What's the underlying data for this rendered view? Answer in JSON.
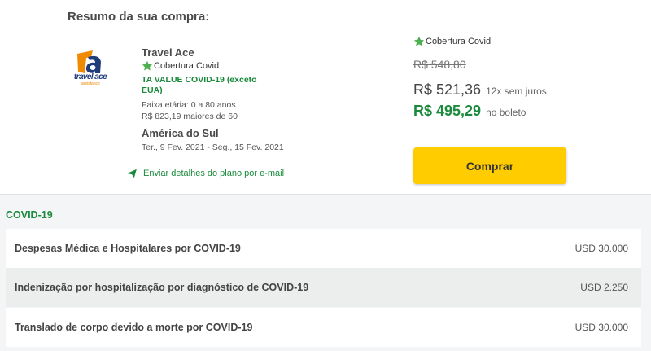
{
  "summary": {
    "heading": "Resumo da sua compra:"
  },
  "logo": {
    "brand": "travel ace",
    "sub": "assistance"
  },
  "plan": {
    "name": "Travel Ace",
    "covid_badge": "Cobertura Covid",
    "code": "TA VALUE COVID-19 (exceto EUA)",
    "age_range": "Faixa etária: 0 a 80 anos",
    "age_price": "R$ 823,19 maiores de 60",
    "region": "América do Sul",
    "dates": "Ter., 9 Fev. 2021 - Seg., 15 Fev. 2021",
    "send_email": "Enviar detalhes do plano por e-mail"
  },
  "pricing": {
    "covid_badge": "Cobertura Covid",
    "old_price": "R$ 548,80",
    "price": "R$ 521,36",
    "installments": "12x sem juros",
    "boleto_price": "R$ 495,29",
    "boleto_label": "no boleto",
    "buy_label": "Comprar"
  },
  "coverage": {
    "title": "COVID-19",
    "rows": [
      {
        "label": "Despesas Médica e Hospitalares por COVID-19",
        "value": "USD 30.000"
      },
      {
        "label": "Indenização por hospitalização por diagnóstico de COVID-19",
        "value": "USD 2.250"
      },
      {
        "label": "Translado de corpo devido a morte por COVID-19",
        "value": "USD 30.000"
      }
    ]
  },
  "colors": {
    "green": "#1a8a3c",
    "yellow": "#ffcc00",
    "star": "#4caf50"
  }
}
